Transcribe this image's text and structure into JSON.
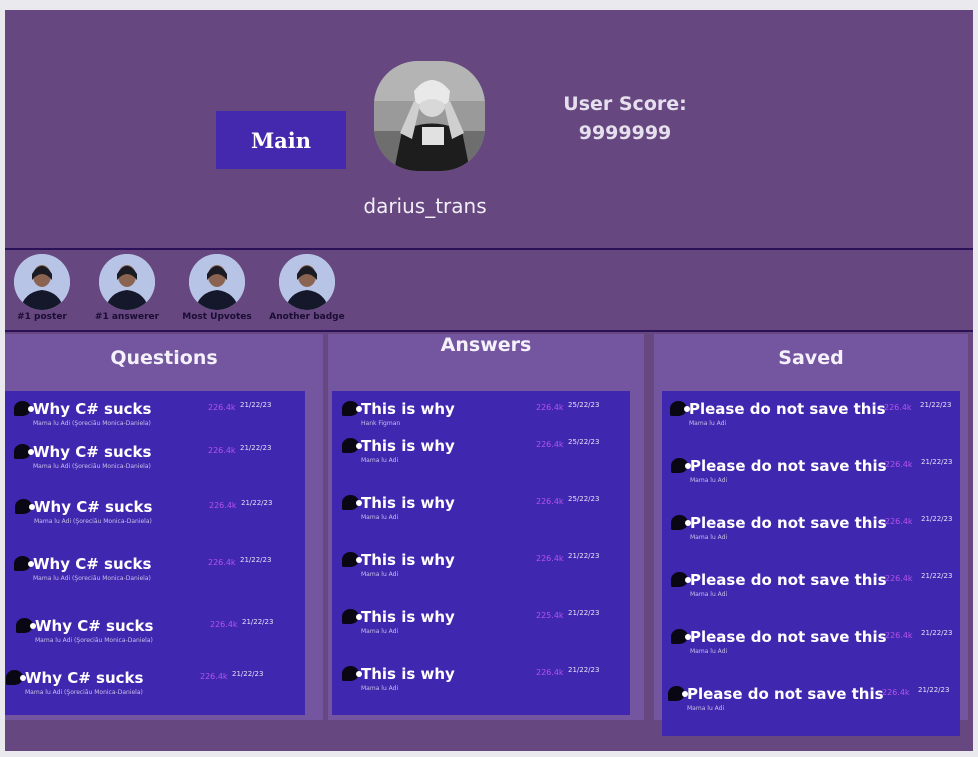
{
  "header": {
    "main_button": "Main",
    "username": "darius_trans",
    "score_label": "User Score:",
    "score_value": "9999999"
  },
  "badges": [
    {
      "label": "#1 poster",
      "icon": "portrait-badge-icon"
    },
    {
      "label": "#1 answerer",
      "icon": "portrait-badge-icon"
    },
    {
      "label": "Most Upvotes",
      "icon": "portrait-badge-icon"
    },
    {
      "label": "Another badge",
      "icon": "portrait-badge-icon"
    }
  ],
  "questions": {
    "title": "Questions",
    "items": [
      {
        "title": "Why C# sucks",
        "author": "Mama lu Adi (Şoreciău Monica-Daniela)",
        "votes": "226.4k",
        "date": "21/22/23"
      },
      {
        "title": "Why C# sucks",
        "author": "Mama lu Adi (Şoreciău Monica-Daniela)",
        "votes": "226.4k",
        "date": "21/22/23"
      },
      {
        "title": "Why C# sucks",
        "author": "Mama lu Adi (Şoreciău Monica-Daniela)",
        "votes": "226.4k",
        "date": "21/22/23"
      },
      {
        "title": "Why C# sucks",
        "author": "Mama lu Adi (Şoreciău Monica-Daniela)",
        "votes": "226.4k",
        "date": "21/22/23"
      },
      {
        "title": "Why C# sucks",
        "author": "Mama lu Adi (Şoreciău Monica-Daniela)",
        "votes": "226.4k",
        "date": "21/22/23"
      },
      {
        "title": "Why C# sucks",
        "author": "Mama lu Adi (Şoreciău Monica-Daniela)",
        "votes": "226.4k",
        "date": "21/22/23"
      }
    ]
  },
  "answers": {
    "title": "Answers",
    "items": [
      {
        "title": "This is why",
        "author": "Hank Figman",
        "votes": "226.4k",
        "date": "25/22/23"
      },
      {
        "title": "This is why",
        "author": "Mama lu Adi",
        "votes": "226.4k",
        "date": "25/22/23"
      },
      {
        "title": "This is why",
        "author": "Mama lu Adi",
        "votes": "226.4k",
        "date": "25/22/23"
      },
      {
        "title": "This is why",
        "author": "Mama lu Adi",
        "votes": "226.4k",
        "date": "21/22/23"
      },
      {
        "title": "This is why",
        "author": "Mama lu Adi",
        "votes": "225.4k",
        "date": "21/22/23"
      },
      {
        "title": "This is why",
        "author": "Mama lu Adi",
        "votes": "226.4k",
        "date": "21/22/23"
      }
    ]
  },
  "saved": {
    "title": "Saved",
    "items": [
      {
        "title": "Please do not save this",
        "author": "Mama lu Adi",
        "votes": "226.4k",
        "date": "21/22/23"
      },
      {
        "title": "Please do not save this",
        "author": "Mama lu Adi",
        "votes": "226.4k",
        "date": "21/22/23"
      },
      {
        "title": "Please do not save this",
        "author": "Mama lu Adi",
        "votes": "226.4k",
        "date": "21/22/23"
      },
      {
        "title": "Please do not save this",
        "author": "Mama lu Adi",
        "votes": "226.4k",
        "date": "21/22/23"
      },
      {
        "title": "Please do not save this",
        "author": "Mama lu Adi",
        "votes": "226.4k",
        "date": "21/22/23"
      },
      {
        "title": "Please do not save this",
        "author": "Mama lu Adi",
        "votes": "226.4k",
        "date": "21/22/23"
      }
    ]
  },
  "colors": {
    "background": "#66477f",
    "card": "#4027b0",
    "button": "#4429ae",
    "votes": "#b454ea",
    "divider": "#2b1157"
  }
}
